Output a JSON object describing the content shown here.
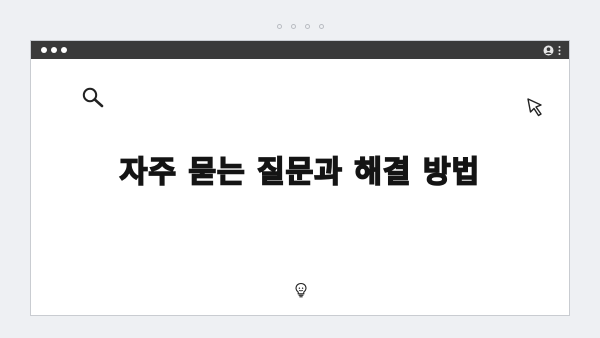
{
  "slide_indicator": {
    "count": 4
  },
  "window": {
    "title_bar": {
      "controls": [
        "window-dot",
        "window-dot",
        "window-dot"
      ],
      "right_icons": [
        "user-icon",
        "kebab-menu-icon"
      ]
    },
    "content": {
      "heading": "자주 묻는 질문과 해결 방법",
      "icons": [
        "search-icon",
        "cursor-arrow-icon",
        "lightbulb-icon"
      ]
    }
  },
  "colors": {
    "title_bar": "#3a3a3a",
    "background": "#eef0f3",
    "window": "#ffffff",
    "heading": "#141414"
  }
}
